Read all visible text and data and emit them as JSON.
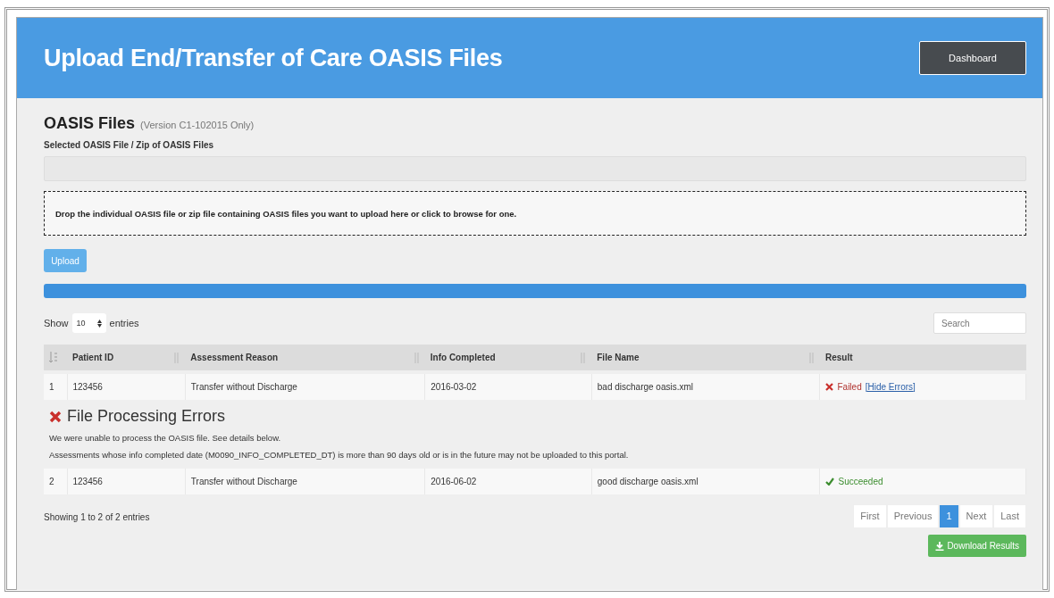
{
  "header": {
    "title": "Upload End/Transfer of Care OASIS Files",
    "button": "Dashboard"
  },
  "form": {
    "heading": "OASIS Files",
    "version": "(Version C1-102015 Only)",
    "field_label": "Selected OASIS File / Zip of OASIS Files",
    "dropzone": "Drop the individual OASIS file or zip file containing OASIS files you want to upload here or click to browse for one.",
    "upload_button": "Upload",
    "progress": {
      "level": 1
    }
  },
  "table_controls": {
    "show": "Show",
    "page_size": "10",
    "entries": "entries",
    "search": {
      "placeholder": "Search"
    }
  },
  "table": {
    "columns": [
      "Patient ID",
      "Assessment Reason",
      "Info Completed",
      "File Name",
      "Result"
    ],
    "rows": [
      {
        "index": "1",
        "patient_id": "123456",
        "reason": "Transfer without Discharge",
        "info_completed": "2016-03-02",
        "file_name": "bad discharge oasis.xml",
        "result": {
          "kind": "failed",
          "text": "Failed",
          "link": "[Hide Errors]"
        },
        "errors": {
          "title": "File Processing Errors",
          "lines": [
            "We were unable to process the OASIS file. See details below.",
            "Assessments whose info completed date (M0090_INFO_COMPLETED_DT) is more than 90 days old or is in the future may not be uploaded to this portal."
          ]
        }
      },
      {
        "index": "2",
        "patient_id": "123456",
        "reason": "Transfer without Discharge",
        "info_completed": "2016-06-02",
        "file_name": "good discharge oasis.xml",
        "result": {
          "kind": "succeeded",
          "text": "Succeeded"
        }
      }
    ]
  },
  "footer": {
    "info": "Showing 1 to 2 of 2 entries",
    "pagination": [
      {
        "label": "First",
        "selected": false
      },
      {
        "label": "Previous",
        "selected": false
      },
      {
        "label": "1",
        "selected": true
      },
      {
        "label": "Next",
        "selected": false
      },
      {
        "label": "Last",
        "selected": false
      }
    ],
    "download_button": "Download Results"
  }
}
